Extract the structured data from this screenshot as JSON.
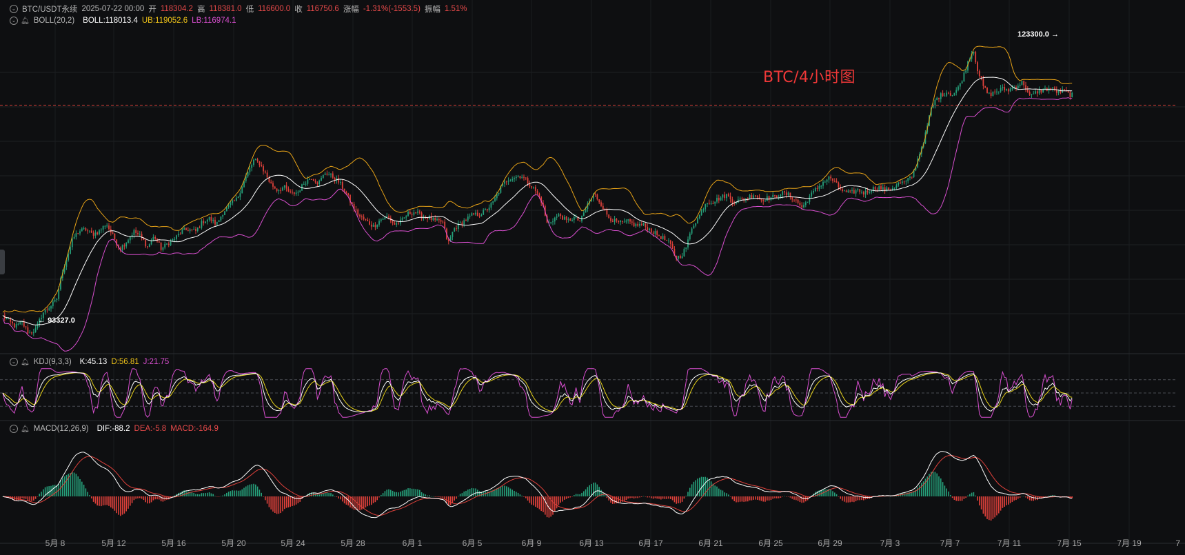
{
  "ohlc_header": {
    "symbol": "BTC/USDT永续",
    "datetime": "2025-07-22 00:00",
    "open_label": "开",
    "open": "118304.2",
    "high_label": "高",
    "high": "118381.0",
    "low_label": "低",
    "low": "116600.0",
    "close_label": "收",
    "close": "116750.6",
    "change_label": "涨幅",
    "change": "-1.31%(-1553.5)",
    "amplitude_label": "振幅",
    "amplitude": "1.51%"
  },
  "boll_header": {
    "name": "BOLL(20,2)",
    "mid": "BOLL:118013.4",
    "ub": "UB:119052.6",
    "lb": "LB:116974.1"
  },
  "kdj_header": {
    "name": "KDJ(9,3,3)",
    "k": "K:45.13",
    "d": "D:56.81",
    "j": "J:21.75"
  },
  "macd_header": {
    "name": "MACD(12,26,9)",
    "dif": "DIF:-88.2",
    "dea": "DEA:-5.8",
    "macd": "MACD:-164.9"
  },
  "watermark_title": "BTC/4小时图",
  "max_annotation": "123300.0",
  "min_annotation": "93327.0",
  "colors": {
    "up": "#26a17b",
    "down": "#e0413b",
    "boll_mid": "#ffffff",
    "boll_ub": "#e8a317",
    "boll_lb": "#d94fd0",
    "kdj_k": "#ffffff",
    "kdj_d": "#e8d31a",
    "kdj_j": "#d94fd0",
    "macd_dif": "#ffffff",
    "macd_dea": "#e0413b",
    "price_line": "#e0413b"
  },
  "chart_data": {
    "type": "line",
    "price_range": [
      92000,
      125000
    ],
    "current_price": 116750.6,
    "x_tick_labels": [
      "5月 8",
      "5月 12",
      "5月 16",
      "5月 20",
      "5月 24",
      "5月 28",
      "6月 1",
      "6月 5",
      "6月 9",
      "6月 13",
      "6月 17",
      "6月 21",
      "6月 25",
      "6月 29",
      "7月 3",
      "7月 7",
      "7月 11",
      "7月 15",
      "7月 19",
      "7"
    ],
    "series": [
      {
        "values": [
          [
            0,
            95500
          ],
          [
            12,
            94800
          ],
          [
            22,
            94200
          ],
          [
            32,
            94600
          ],
          [
            42,
            93500
          ],
          [
            52,
            93900
          ],
          [
            62,
            95600
          ],
          [
            72,
            96200
          ],
          [
            82,
            96900
          ],
          [
            90,
            99700
          ],
          [
            98,
            101400
          ],
          [
            106,
            103200
          ],
          [
            114,
            103900
          ],
          [
            124,
            104100
          ],
          [
            134,
            103600
          ],
          [
            144,
            103900
          ],
          [
            154,
            104700
          ],
          [
            164,
            103400
          ],
          [
            174,
            102100
          ],
          [
            184,
            102900
          ],
          [
            194,
            103900
          ],
          [
            204,
            103400
          ],
          [
            214,
            102300
          ],
          [
            224,
            103400
          ],
          [
            234,
            102100
          ],
          [
            244,
            102700
          ],
          [
            254,
            103200
          ],
          [
            264,
            103900
          ],
          [
            274,
            104100
          ],
          [
            284,
            103900
          ],
          [
            294,
            104900
          ],
          [
            304,
            105200
          ],
          [
            314,
            104600
          ],
          [
            324,
            105900
          ],
          [
            334,
            106600
          ],
          [
            344,
            107200
          ],
          [
            352,
            108700
          ],
          [
            360,
            109900
          ],
          [
            368,
            111100
          ],
          [
            376,
            110900
          ],
          [
            384,
            109900
          ],
          [
            392,
            108800
          ],
          [
            402,
            108100
          ],
          [
            412,
            108400
          ],
          [
            422,
            107700
          ],
          [
            432,
            107900
          ],
          [
            442,
            108900
          ],
          [
            452,
            109400
          ],
          [
            462,
            108800
          ],
          [
            472,
            109900
          ],
          [
            482,
            109500
          ],
          [
            492,
            108900
          ],
          [
            502,
            107800
          ],
          [
            512,
            106400
          ],
          [
            522,
            105400
          ],
          [
            532,
            104900
          ],
          [
            542,
            104400
          ],
          [
            552,
            105100
          ],
          [
            562,
            105400
          ],
          [
            572,
            104600
          ],
          [
            582,
            104900
          ],
          [
            592,
            105700
          ],
          [
            602,
            105900
          ],
          [
            612,
            105400
          ],
          [
            622,
            105300
          ],
          [
            632,
            104900
          ],
          [
            642,
            104900
          ],
          [
            650,
            102600
          ],
          [
            658,
            104100
          ],
          [
            666,
            104600
          ],
          [
            676,
            105100
          ],
          [
            686,
            105600
          ],
          [
            696,
            105600
          ],
          [
            706,
            106100
          ],
          [
            716,
            106900
          ],
          [
            726,
            108300
          ],
          [
            736,
            109200
          ],
          [
            746,
            109400
          ],
          [
            756,
            109600
          ],
          [
            766,
            108900
          ],
          [
            776,
            108100
          ],
          [
            786,
            106900
          ],
          [
            794,
            104600
          ],
          [
            802,
            105100
          ],
          [
            812,
            105600
          ],
          [
            822,
            104900
          ],
          [
            832,
            105300
          ],
          [
            842,
            104900
          ],
          [
            852,
            106600
          ],
          [
            862,
            107700
          ],
          [
            872,
            106700
          ],
          [
            882,
            105400
          ],
          [
            892,
            104900
          ],
          [
            902,
            104700
          ],
          [
            912,
            104900
          ],
          [
            922,
            104500
          ],
          [
            932,
            104600
          ],
          [
            942,
            104100
          ],
          [
            952,
            103600
          ],
          [
            962,
            103200
          ],
          [
            972,
            102600
          ],
          [
            980,
            101200
          ],
          [
            988,
            101400
          ],
          [
            996,
            102400
          ],
          [
            1004,
            104400
          ],
          [
            1014,
            105400
          ],
          [
            1024,
            106900
          ],
          [
            1034,
            106900
          ],
          [
            1044,
            107300
          ],
          [
            1054,
            107600
          ],
          [
            1064,
            106900
          ],
          [
            1074,
            107100
          ],
          [
            1084,
            107300
          ],
          [
            1094,
            107700
          ],
          [
            1104,
            107100
          ],
          [
            1114,
            107300
          ],
          [
            1124,
            107400
          ],
          [
            1134,
            107800
          ],
          [
            1144,
            107600
          ],
          [
            1154,
            107100
          ],
          [
            1164,
            106300
          ],
          [
            1174,
            107400
          ],
          [
            1184,
            108200
          ],
          [
            1194,
            108900
          ],
          [
            1204,
            109400
          ],
          [
            1214,
            108600
          ],
          [
            1224,
            107900
          ],
          [
            1234,
            107800
          ],
          [
            1244,
            108100
          ],
          [
            1254,
            107800
          ],
          [
            1264,
            108200
          ],
          [
            1274,
            108400
          ],
          [
            1284,
            108100
          ],
          [
            1294,
            108300
          ],
          [
            1304,
            108800
          ],
          [
            1314,
            108900
          ],
          [
            1324,
            109600
          ],
          [
            1334,
            111900
          ],
          [
            1342,
            113600
          ],
          [
            1350,
            116200
          ],
          [
            1358,
            117400
          ],
          [
            1366,
            117800
          ],
          [
            1374,
            118100
          ],
          [
            1382,
            117800
          ],
          [
            1390,
            118500
          ],
          [
            1398,
            119800
          ],
          [
            1406,
            121600
          ],
          [
            1412,
            122400
          ],
          [
            1418,
            120400
          ],
          [
            1426,
            118700
          ],
          [
            1434,
            117800
          ],
          [
            1444,
            118100
          ],
          [
            1454,
            118400
          ],
          [
            1464,
            118300
          ],
          [
            1474,
            118700
          ],
          [
            1484,
            119100
          ],
          [
            1494,
            117600
          ],
          [
            1504,
            118100
          ],
          [
            1514,
            118300
          ],
          [
            1524,
            118500
          ],
          [
            1534,
            118100
          ],
          [
            1544,
            118200
          ],
          [
            1552,
            117800
          ]
        ]
      }
    ]
  }
}
